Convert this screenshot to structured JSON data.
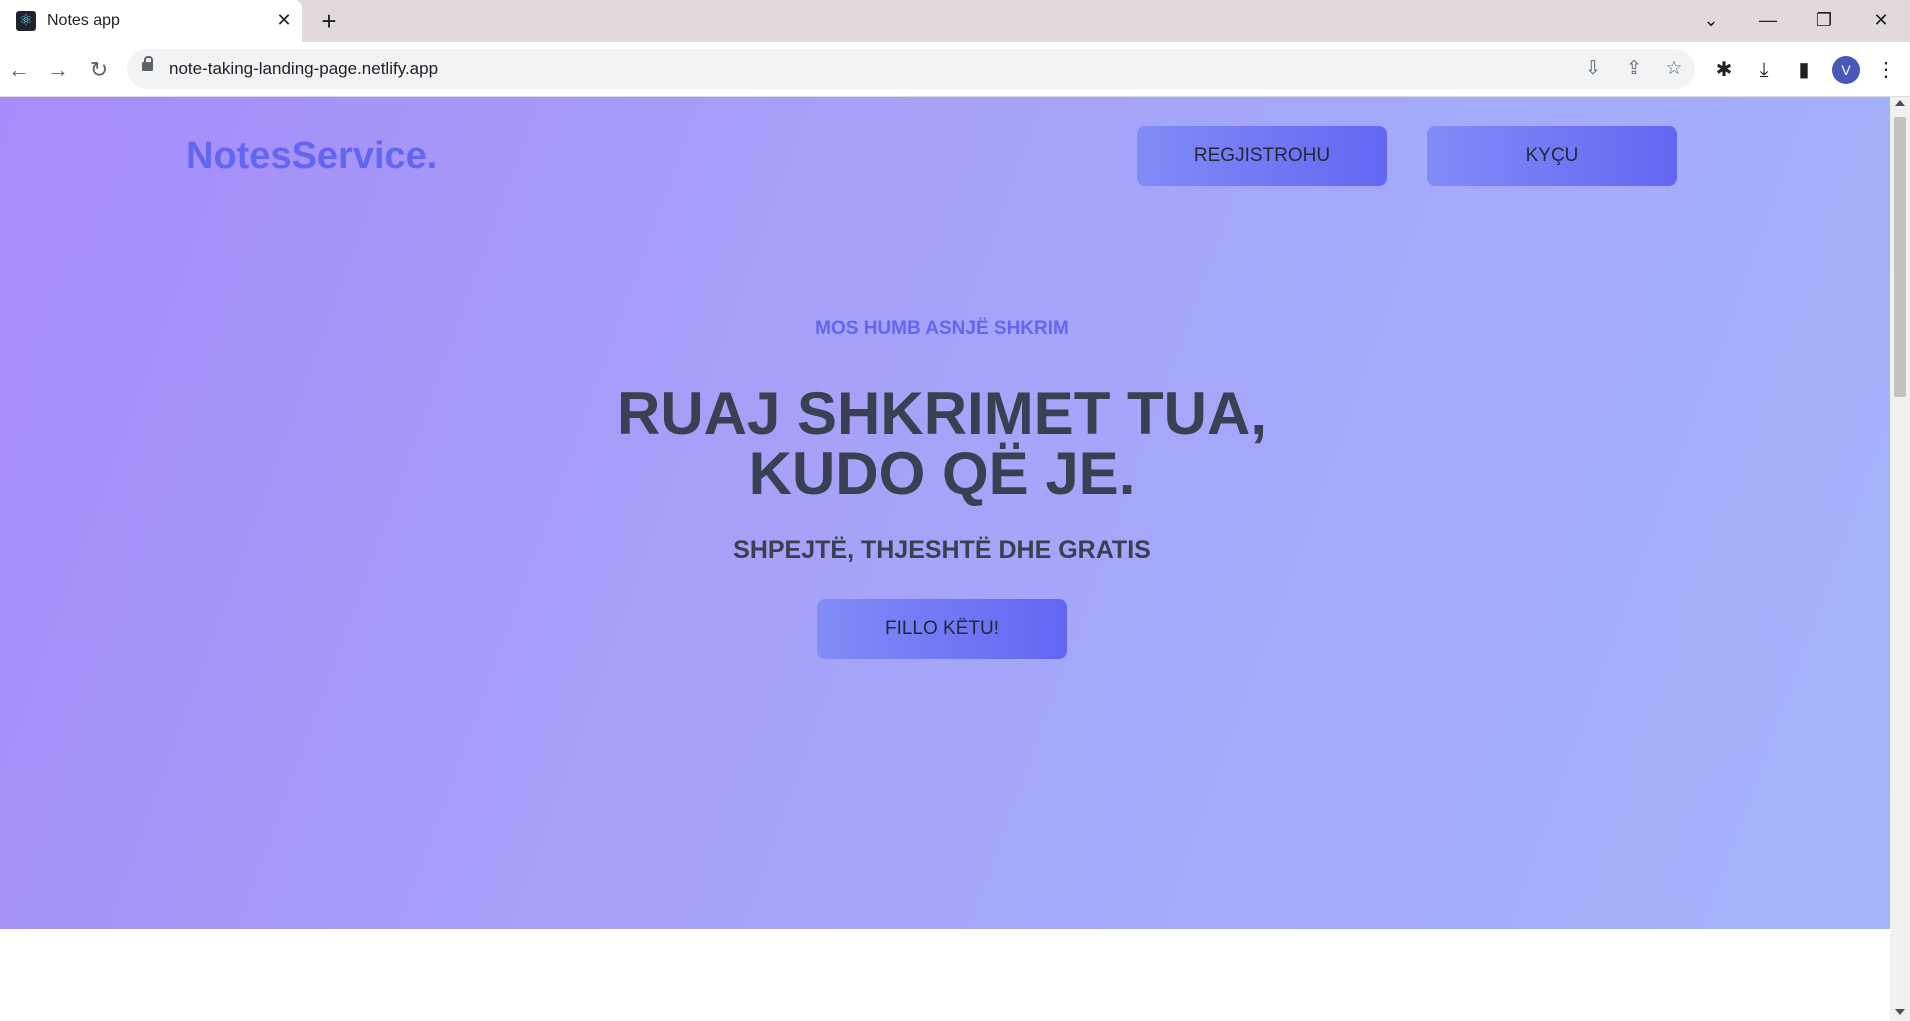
{
  "browser": {
    "tab_title": "Notes app",
    "url": "note-taking-landing-page.netlify.app",
    "profile_initial": "V",
    "icons": {
      "favicon": "react-icon",
      "close": "close-icon",
      "new_tab": "plus-icon",
      "back": "back-arrow-icon",
      "forward": "forward-arrow-icon",
      "reload": "reload-icon"
    }
  },
  "page": {
    "logo": "NotesService.",
    "nav": {
      "register": "REGJISTROHU",
      "login": "KYÇU"
    },
    "kicker": "MOS HUMB ASNJË SHKRIM",
    "headline_line1": "RUAJ SHKRIMET TUA,",
    "headline_line2": "KUDO QË JE.",
    "subheadline": "SHPEJTË, THJESHTË DHE  GRATIS",
    "cta": "FILLO KËTU!"
  },
  "colors": {
    "accent": "#6366f1",
    "text_dark": "#374151",
    "gradient_start": "#a78bfa",
    "gradient_end": "#a5b4fc"
  }
}
